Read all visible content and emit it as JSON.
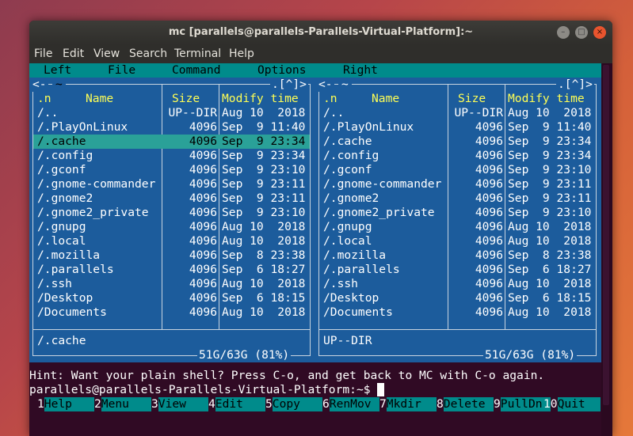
{
  "window": {
    "title": "mc [parallels@parallels-Parallels-Virtual-Platform]:~",
    "buttons": {
      "minimize": "–",
      "maximize": "□",
      "close": "×"
    }
  },
  "menubar": [
    "File",
    "Edit",
    "View",
    "Search",
    "Terminal",
    "Help"
  ],
  "mc_menu": [
    "Left",
    "File",
    "Command",
    "Options",
    "Right"
  ],
  "left_panel": {
    "path_prefix": "<-",
    "path": "~",
    "path_suffix": ".[^]>",
    "columns": {
      "sort": ".n",
      "name": "Name",
      "size": "Size",
      "modify": "Modify time"
    },
    "rows": [
      {
        "name": "/..",
        "size": "UP--DIR",
        "date": "Aug 10  2018"
      },
      {
        "name": "/.PlayOnLinux",
        "size": "4096",
        "date": "Sep  9 11:40"
      },
      {
        "name": "/.cache",
        "size": "4096",
        "date": "Sep  9 23:34",
        "selected": true
      },
      {
        "name": "/.config",
        "size": "4096",
        "date": "Sep  9 23:34"
      },
      {
        "name": "/.gconf",
        "size": "4096",
        "date": "Sep  9 23:10"
      },
      {
        "name": "/.gnome-commander",
        "size": "4096",
        "date": "Sep  9 23:11"
      },
      {
        "name": "/.gnome2",
        "size": "4096",
        "date": "Sep  9 23:11"
      },
      {
        "name": "/.gnome2_private",
        "size": "4096",
        "date": "Sep  9 23:10"
      },
      {
        "name": "/.gnupg",
        "size": "4096",
        "date": "Aug 10  2018"
      },
      {
        "name": "/.local",
        "size": "4096",
        "date": "Aug 10  2018"
      },
      {
        "name": "/.mozilla",
        "size": "4096",
        "date": "Sep  8 23:38"
      },
      {
        "name": "/.parallels",
        "size": "4096",
        "date": "Sep  6 18:27"
      },
      {
        "name": "/.ssh",
        "size": "4096",
        "date": "Aug 10  2018"
      },
      {
        "name": "/Desktop",
        "size": "4096",
        "date": "Sep  6 18:15"
      },
      {
        "name": "/Documents",
        "size": "4096",
        "date": "Aug 10  2018"
      }
    ],
    "status": "/.cache",
    "disk": "51G/63G (81%)"
  },
  "right_panel": {
    "path_prefix": "<-",
    "path": "~",
    "path_suffix": ".[^]>",
    "columns": {
      "sort": ".n",
      "name": "Name",
      "size": "Size",
      "modify": "Modify time"
    },
    "rows": [
      {
        "name": "/..",
        "size": "UP--DIR",
        "date": "Aug 10  2018"
      },
      {
        "name": "/.PlayOnLinux",
        "size": "4096",
        "date": "Sep  9 11:40"
      },
      {
        "name": "/.cache",
        "size": "4096",
        "date": "Sep  9 23:34"
      },
      {
        "name": "/.config",
        "size": "4096",
        "date": "Sep  9 23:34"
      },
      {
        "name": "/.gconf",
        "size": "4096",
        "date": "Sep  9 23:10"
      },
      {
        "name": "/.gnome-commander",
        "size": "4096",
        "date": "Sep  9 23:11"
      },
      {
        "name": "/.gnome2",
        "size": "4096",
        "date": "Sep  9 23:11"
      },
      {
        "name": "/.gnome2_private",
        "size": "4096",
        "date": "Sep  9 23:10"
      },
      {
        "name": "/.gnupg",
        "size": "4096",
        "date": "Aug 10  2018"
      },
      {
        "name": "/.local",
        "size": "4096",
        "date": "Aug 10  2018"
      },
      {
        "name": "/.mozilla",
        "size": "4096",
        "date": "Sep  8 23:38"
      },
      {
        "name": "/.parallels",
        "size": "4096",
        "date": "Sep  6 18:27"
      },
      {
        "name": "/.ssh",
        "size": "4096",
        "date": "Aug 10  2018"
      },
      {
        "name": "/Desktop",
        "size": "4096",
        "date": "Sep  6 18:15"
      },
      {
        "name": "/Documents",
        "size": "4096",
        "date": "Aug 10  2018"
      }
    ],
    "status": "UP--DIR",
    "disk": "51G/63G (81%)"
  },
  "hint": "Hint: Want your plain shell? Press C-o, and get back to MC with C-o again.",
  "prompt": "parallels@parallels-Parallels-Virtual-Platform:~$ ",
  "fkeys": [
    {
      "num": "1",
      "label": "Help"
    },
    {
      "num": "2",
      "label": "Menu"
    },
    {
      "num": "3",
      "label": "View"
    },
    {
      "num": "4",
      "label": "Edit"
    },
    {
      "num": "5",
      "label": "Copy"
    },
    {
      "num": "6",
      "label": "RenMov"
    },
    {
      "num": "7",
      "label": "Mkdir"
    },
    {
      "num": "8",
      "label": "Delete"
    },
    {
      "num": "9",
      "label": "PullDn"
    },
    {
      "num": "10",
      "label": "Quit"
    }
  ],
  "colors": {
    "panel_bg": "#1c5c9c",
    "menu_bg": "#008b8b",
    "header_fg": "#ffff55",
    "selection_bg": "#2aa198",
    "terminal_bg": "#300a24"
  }
}
